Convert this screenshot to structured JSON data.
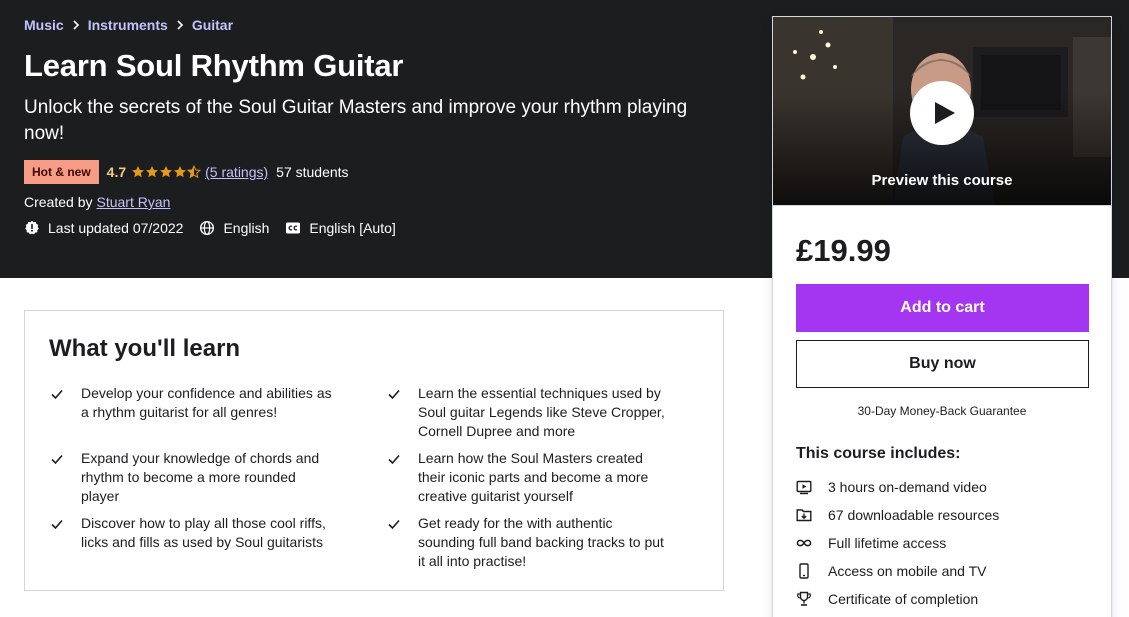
{
  "breadcrumb": [
    "Music",
    "Instruments",
    "Guitar"
  ],
  "course": {
    "title": "Learn Soul Rhythm Guitar",
    "subtitle": "Unlock the secrets of the Soul Guitar Masters and improve your rhythm playing now!",
    "badge": "Hot & new",
    "rating": "4.7",
    "rating_value": 4.7,
    "ratings_count": "(5 ratings)",
    "students": "57 students",
    "created_by_label": "Created by",
    "author": "Stuart Ryan",
    "last_updated": "Last updated 07/2022",
    "language": "English",
    "captions": "English [Auto]"
  },
  "sidebar": {
    "preview_label": "Preview this course",
    "price": "£19.99",
    "add_to_cart": "Add to cart",
    "buy_now": "Buy now",
    "guarantee": "30-Day Money-Back Guarantee",
    "includes_title": "This course includes:",
    "includes": [
      {
        "icon": "video-icon",
        "text": "3 hours on-demand video"
      },
      {
        "icon": "download-folder-icon",
        "text": "67 downloadable resources"
      },
      {
        "icon": "infinity-icon",
        "text": "Full lifetime access"
      },
      {
        "icon": "mobile-icon",
        "text": "Access on mobile and TV"
      },
      {
        "icon": "trophy-icon",
        "text": "Certificate of completion"
      }
    ]
  },
  "learn": {
    "title": "What you'll learn",
    "items": [
      "Develop your confidence and abilities as a rhythm guitarist for all genres!",
      "Learn the essential techniques used by Soul guitar Legends like Steve Cropper, Cornell Dupree and more",
      "Expand your knowledge of chords and rhythm to become a more rounded player",
      "Learn how the Soul Masters created their iconic parts and become a more creative guitarist yourself",
      "Discover how to play all those cool riffs, licks and fills as used by Soul guitarists",
      "Get ready for the with authentic sounding full band backing tracks to put it all into practise!"
    ]
  },
  "colors": {
    "hero_bg": "#1c1d1f",
    "link": "#c0c4fc",
    "rating": "#f3ca8c",
    "badge_hot": "#f69c86",
    "primary_button": "#a435f0"
  }
}
